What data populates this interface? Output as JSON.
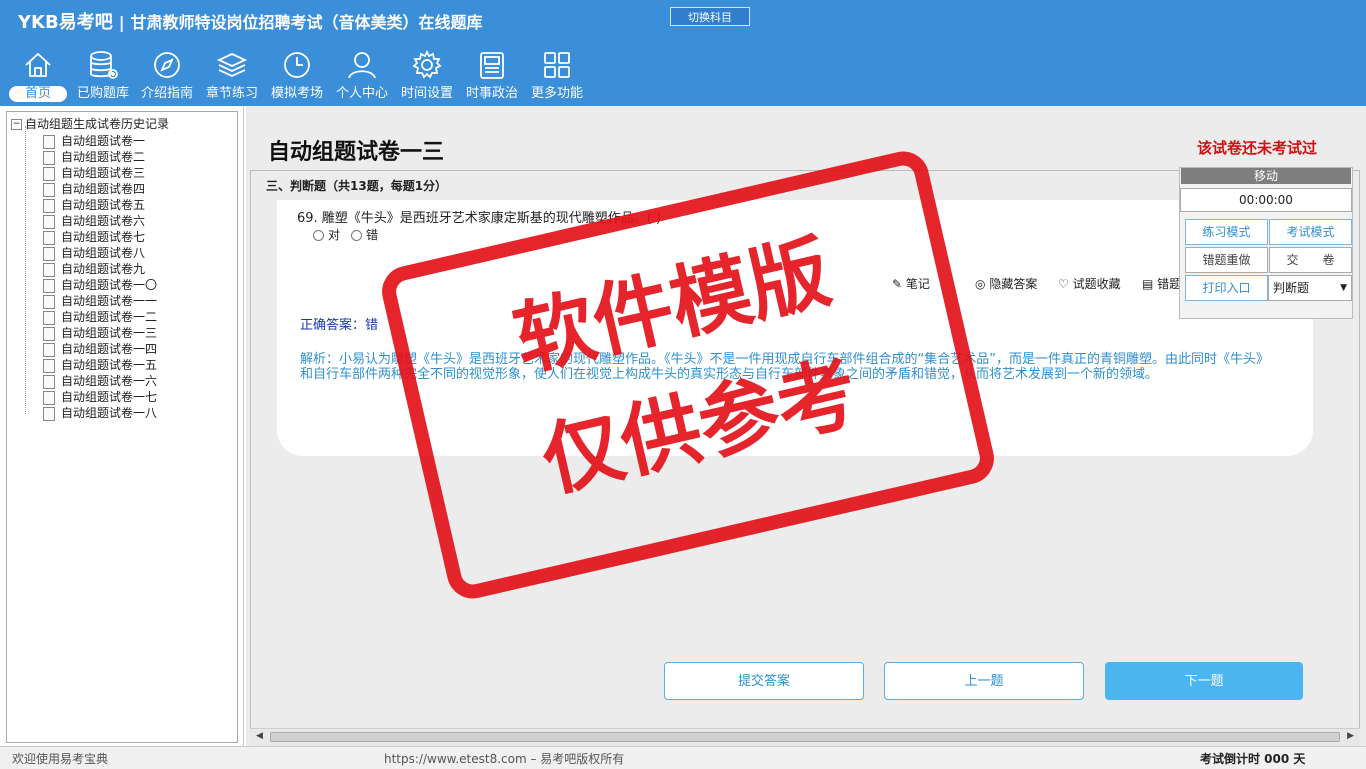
{
  "header": {
    "logo": "YKB易考吧",
    "title": "甘肃教师特设岗位招聘考试（音体美类）在线题库",
    "switch_subject": "切换科目",
    "nav": [
      {
        "label": "首页",
        "icon": "home-icon"
      },
      {
        "label": "已购题库",
        "icon": "database-icon"
      },
      {
        "label": "介绍指南",
        "icon": "compass-icon"
      },
      {
        "label": "章节练习",
        "icon": "layers-icon"
      },
      {
        "label": "模拟考场",
        "icon": "clock-icon"
      },
      {
        "label": "个人中心",
        "icon": "user-icon"
      },
      {
        "label": "时间设置",
        "icon": "gear-icon"
      },
      {
        "label": "时事政治",
        "icon": "news-icon"
      },
      {
        "label": "更多功能",
        "icon": "grid-icon"
      }
    ]
  },
  "sidebar": {
    "root": "自动组题生成试卷历史记录",
    "items": [
      "自动组题试卷一",
      "自动组题试卷二",
      "自动组题试卷三",
      "自动组题试卷四",
      "自动组题试卷五",
      "自动组题试卷六",
      "自动组题试卷七",
      "自动组题试卷八",
      "自动组题试卷九",
      "自动组题试卷一〇",
      "自动组题试卷一一",
      "自动组题试卷一二",
      "自动组题试卷一三",
      "自动组题试卷一四",
      "自动组题试卷一五",
      "自动组题试卷一六",
      "自动组题试卷一七",
      "自动组题试卷一八"
    ]
  },
  "main": {
    "paper_title": "自动组题试卷一三",
    "status": "该试卷还未考试过",
    "section": "三、判断题（共13题，每题1分）",
    "question": "69. 雕塑《牛头》是西班牙艺术家康定斯基的现代雕塑作品。( )",
    "options": [
      "对",
      "错"
    ],
    "tools": [
      "笔记",
      "隐藏答案",
      "试题收藏",
      "错题"
    ],
    "answer": "正确答案：错",
    "analysis": "解析：小易认为雕塑《牛头》是西班牙艺术家的现代雕塑作品。《牛头》不是一件用现成自行车部件组合成的“集合艺术品”，而是一件真正的青铜雕塑。由此同时《牛头》和自行车部件两种完全不同的视觉形象，使人们在视觉上构成牛头的真实形态与自行车部件表象之间的矛盾和错觉，从而将艺术发展到一个新的领域。",
    "buttons": {
      "submit": "提交答案",
      "prev": "上一题",
      "next": "下一题"
    }
  },
  "panel": {
    "move": "移动",
    "timer": "00:00:00",
    "practice": "练习模式",
    "exam": "考试模式",
    "redo": "错题重做",
    "submit_paper": "交　　卷",
    "print": "打印入口",
    "type": "判断题"
  },
  "statusbar": {
    "welcome": "欢迎使用易考宝典",
    "copyright": "https://www.etest8.com – 易考吧版权所有",
    "countdown": "考试倒计时 000 天"
  },
  "watermark": {
    "line1": "软件模版",
    "line2": "仅供参考"
  },
  "colors": {
    "header": "#3b8fd9",
    "accent": "#4bb5f0",
    "status_red": "#d01010",
    "watermark_red": "#e3121a"
  }
}
